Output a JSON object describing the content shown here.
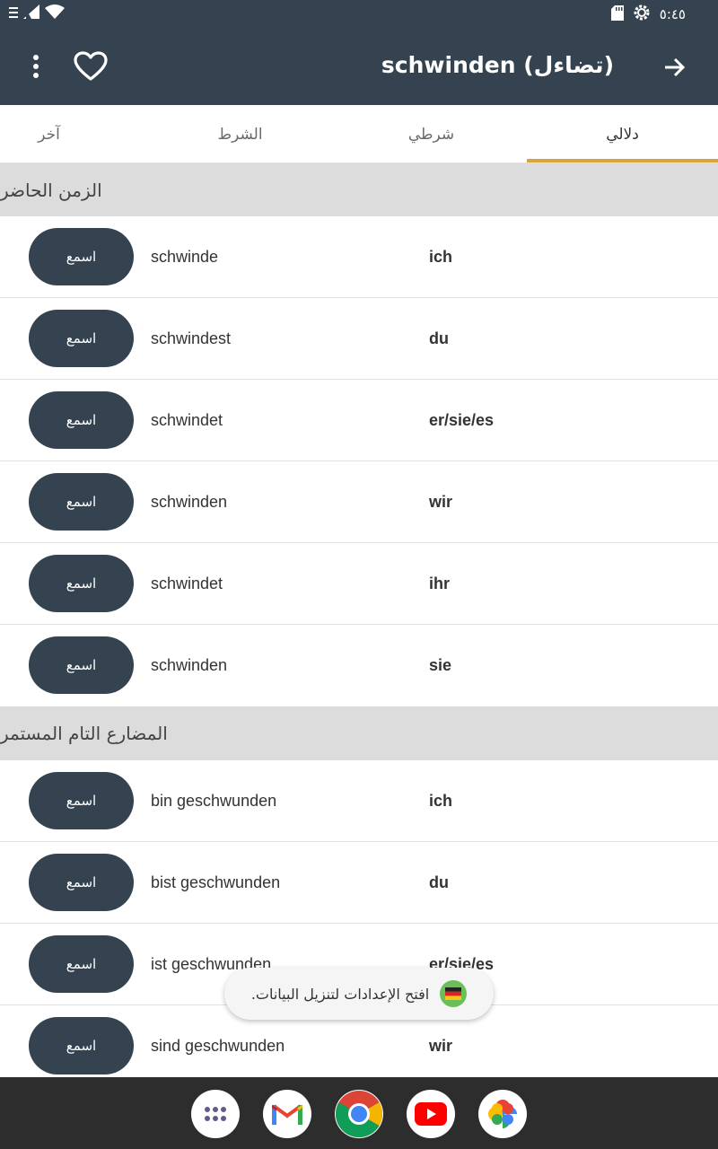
{
  "status_bar": {
    "time": "٥:٤٥",
    "icons": [
      "notification-icon",
      "signal-icon",
      "wifi-icon",
      "sd-card-icon",
      "settings-gear-icon"
    ]
  },
  "app_bar": {
    "title": "schwinden (تضاءل)",
    "icons": [
      "more-vert-icon",
      "heart-outline-icon",
      "arrow-forward-icon"
    ]
  },
  "tabs": [
    {
      "label": "دلالي",
      "active": true
    },
    {
      "label": "شرطي",
      "active": false
    },
    {
      "label": "الشرط",
      "active": false
    },
    {
      "label": "آخر",
      "active": false
    }
  ],
  "colors": {
    "primary": "#34434f",
    "accent": "#d9a33d",
    "section_bg": "#dcdcdc"
  },
  "listen_label": "اسمع",
  "sections": [
    {
      "title": "الزمن الحاضر",
      "rows": [
        {
          "pronoun": "ich",
          "form": "schwinde"
        },
        {
          "pronoun": "du",
          "form": "schwindest"
        },
        {
          "pronoun": "er/sie/es",
          "form": "schwindet"
        },
        {
          "pronoun": "wir",
          "form": "schwinden"
        },
        {
          "pronoun": "ihr",
          "form": "schwindet"
        },
        {
          "pronoun": "sie",
          "form": "schwinden"
        }
      ]
    },
    {
      "title": "المضارع التام المستمر",
      "rows": [
        {
          "pronoun": "ich",
          "form": "bin geschwunden"
        },
        {
          "pronoun": "du",
          "form": "bist geschwunden"
        },
        {
          "pronoun": "er/sie/es",
          "form": "ist geschwunden"
        },
        {
          "pronoun": "wir",
          "form": "sind geschwunden"
        }
      ]
    }
  ],
  "toast": {
    "text": "افتح الإعدادات لتنزيل البيانات.",
    "icon": "german-flag-icon"
  },
  "dock": [
    "app-drawer-icon",
    "gmail-icon",
    "chrome-icon",
    "youtube-icon",
    "photos-icon"
  ]
}
